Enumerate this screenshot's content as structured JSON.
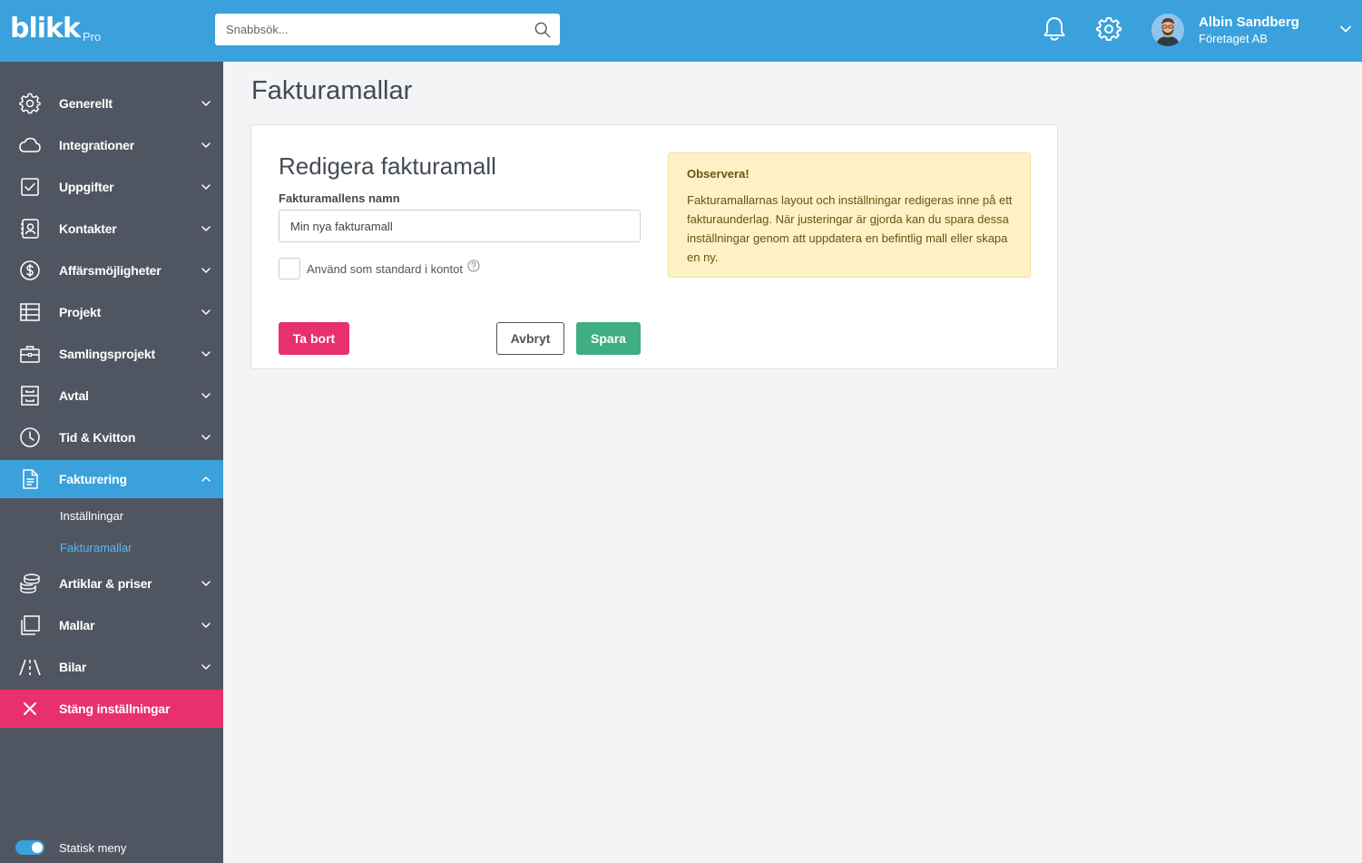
{
  "header": {
    "logo": "blikk",
    "logo_suffix": "Pro",
    "search_placeholder": "Snabbsök...",
    "user": {
      "name": "Albin Sandberg",
      "company": "Företaget AB"
    },
    "icons": [
      "search-icon",
      "bell-icon",
      "gear-icon",
      "avatar",
      "chevron-down-icon"
    ]
  },
  "sidebar": {
    "items": [
      {
        "label": "Generellt",
        "icon": "gear-icon"
      },
      {
        "label": "Integrationer",
        "icon": "cloud-icon"
      },
      {
        "label": "Uppgifter",
        "icon": "checkbox-icon"
      },
      {
        "label": "Kontakter",
        "icon": "contact-icon"
      },
      {
        "label": "Affärsmöjligheter",
        "icon": "dollar-icon"
      },
      {
        "label": "Projekt",
        "icon": "table-icon"
      },
      {
        "label": "Samlingsprojekt",
        "icon": "briefcase-icon"
      },
      {
        "label": "Avtal",
        "icon": "cabinet-icon"
      },
      {
        "label": "Tid & Kvitton",
        "icon": "clock-icon"
      },
      {
        "label": "Fakturering",
        "icon": "document-icon",
        "active": true
      },
      {
        "label": "Artiklar & priser",
        "icon": "coins-icon"
      },
      {
        "label": "Mallar",
        "icon": "copy-icon"
      },
      {
        "label": "Bilar",
        "icon": "road-icon"
      }
    ],
    "sub_items": [
      {
        "label": "Inställningar"
      },
      {
        "label": "Fakturamallar",
        "active": true
      }
    ],
    "close_label": "Stäng inställningar",
    "toggle_label": "Statisk meny",
    "toggle_on": true
  },
  "main": {
    "page_title": "Fakturamallar",
    "card": {
      "title": "Redigera fakturamall",
      "name_label": "Fakturamallens namn",
      "name_value": "Min nya fakturamall",
      "checkbox_label": "Använd som standard i kontot",
      "checkbox_checked": false,
      "delete_label": "Ta bort",
      "cancel_label": "Avbryt",
      "save_label": "Spara"
    },
    "notice": {
      "title": "Observera!",
      "text": "Fakturamallarnas layout och inställningar redigeras inne på ett fakturaunderlag. När justeringar är gjorda kan du spara dessa inställningar genom att uppdatera en befintlig mall eller skapa en ny."
    }
  },
  "colors": {
    "header": "#3aa1dd",
    "sidebar": "#4f5661",
    "active": "#3aa1dd",
    "danger": "#e8306c",
    "success": "#3fae83",
    "notice_bg": "#fdf1c5"
  }
}
